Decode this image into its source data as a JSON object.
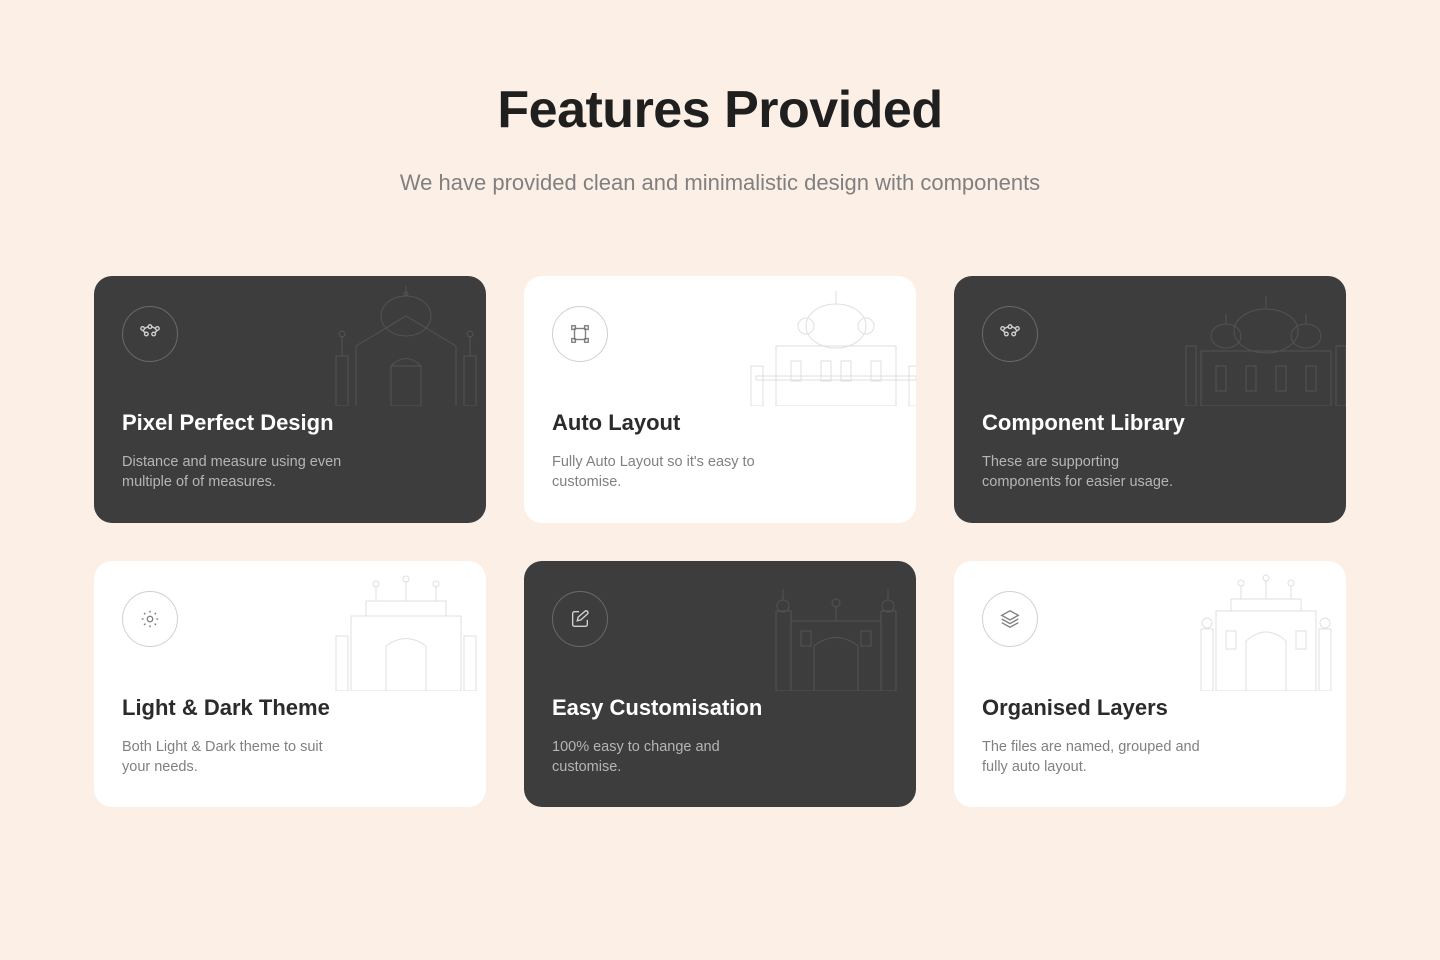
{
  "header": {
    "title": "Features Provided",
    "subtitle": "We have provided clean and minimalistic design with components"
  },
  "cards": [
    {
      "theme": "dark",
      "icon": "nodes-icon",
      "title": "Pixel Perfect Design",
      "description": "Distance and measure using even multiple of of measures."
    },
    {
      "theme": "light",
      "icon": "bounding-box-icon",
      "title": "Auto Layout",
      "description": "Fully Auto Layout so it's easy to customise."
    },
    {
      "theme": "dark",
      "icon": "nodes-icon",
      "title": "Component Library",
      "description": "These are supporting components for easier usage."
    },
    {
      "theme": "light",
      "icon": "sun-icon",
      "title": "Light & Dark Theme",
      "description": "Both Light & Dark theme to suit your needs."
    },
    {
      "theme": "dark",
      "icon": "edit-icon",
      "title": "Easy Customisation",
      "description": "100% easy to change and customise."
    },
    {
      "theme": "light",
      "icon": "layers-icon",
      "title": "Organised Layers",
      "description": "The files are named, grouped and fully auto layout."
    }
  ]
}
